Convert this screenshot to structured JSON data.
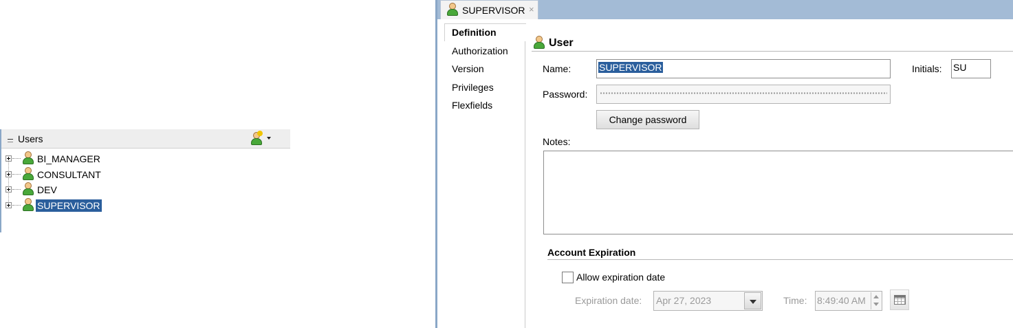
{
  "tree": {
    "header": "Users",
    "items": [
      {
        "label": "BI_MANAGER",
        "selected": false
      },
      {
        "label": "CONSULTANT",
        "selected": false
      },
      {
        "label": "DEV",
        "selected": false
      },
      {
        "label": "SUPERVISOR",
        "selected": true
      }
    ]
  },
  "editor": {
    "tab": {
      "label": "SUPERVISOR",
      "close": "×"
    },
    "nav": [
      "Definition",
      "Authorization",
      "Version",
      "Privileges",
      "Flexfields"
    ],
    "active_nav": "Definition",
    "section_title": "User",
    "name_label": "Name:",
    "name_value": "SUPERVISOR",
    "initials_label": "Initials:",
    "initials_value": "SU",
    "password_label": "Password:",
    "change_password_label": "Change password",
    "notes_label": "Notes:",
    "notes_value": "",
    "account_expiration_title": "Account Expiration",
    "allow_expiration_label": "Allow expiration date",
    "allow_expiration_checked": false,
    "expiration_date_label": "Expiration date:",
    "expiration_date_value": "Apr 27, 2023",
    "time_label": "Time:",
    "time_value": "8:49:40 AM"
  },
  "icons": {
    "user": "user-icon",
    "add_user": "add-user-icon",
    "calendar": "calendar-icon"
  },
  "colors": {
    "selection": "#2a5e9c",
    "tabbar": "#a3bbd6",
    "user_body": "#49a83a"
  }
}
